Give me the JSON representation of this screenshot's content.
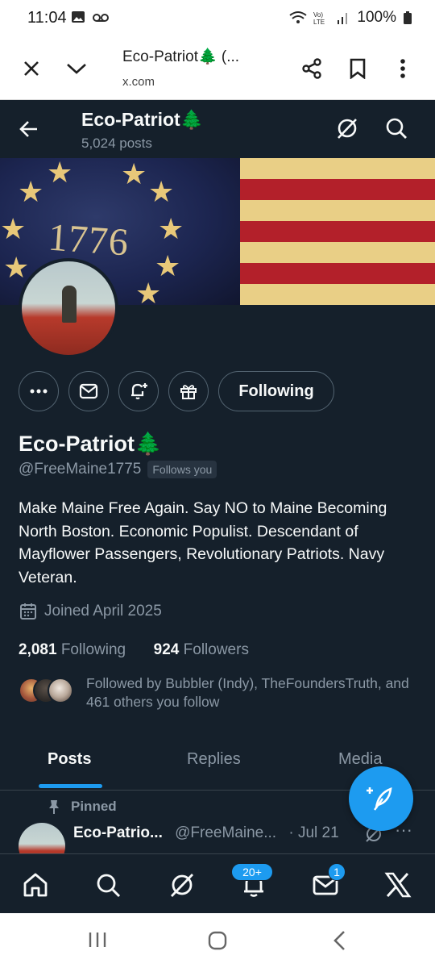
{
  "statusbar": {
    "time": "11:04",
    "battery": "100%"
  },
  "browser": {
    "title": "Eco-Patriot🌲 (...",
    "url": "x.com"
  },
  "header": {
    "name": "Eco-Patriot🌲",
    "post_count": "5,024 posts"
  },
  "banner": {
    "year": "1776"
  },
  "actions": {
    "following_label": "Following"
  },
  "profile": {
    "name": "Eco-Patriot🌲",
    "handle": "@FreeMaine1775",
    "follows_you": "Follows you",
    "bio": "Make Maine Free Again. Say NO to Maine Becoming North Boston. Economic Populist. Descendant of Mayflower Passengers, Revolutionary Patriots. Navy Veteran.",
    "joined": "Joined April 2025",
    "following_count": "2,081",
    "following_label": "Following",
    "followers_count": "924",
    "followers_label": "Followers",
    "followed_by": "Followed by Bubbler (Indy), TheFoundersTruth, and 461 others you follow"
  },
  "tabs": [
    {
      "label": "Posts"
    },
    {
      "label": "Replies"
    },
    {
      "label": "Media"
    }
  ],
  "pinned_post": {
    "pinned_label": "Pinned",
    "author": "Eco-Patrio...",
    "handle": "@FreeMaine...",
    "date": "· Jul 21",
    "more": "···"
  },
  "bottom_nav": {
    "notifications_badge": "20+",
    "messages_badge": "1"
  },
  "colors": {
    "accent": "#1d9bf0",
    "background": "#15202b",
    "secondary_text": "#8b98a5"
  }
}
